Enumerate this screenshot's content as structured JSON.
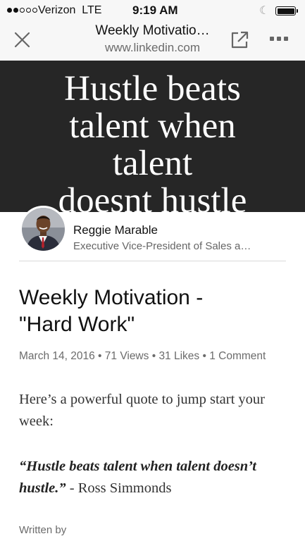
{
  "status_bar": {
    "carrier": "Verizon",
    "network": "LTE",
    "time": "9:19 AM",
    "signal_bars_filled": 2,
    "signal_bars_total": 5,
    "battery_level": 1.0
  },
  "nav": {
    "title": "Weekly Motivatio…",
    "url": "www.linkedin.com"
  },
  "hero": {
    "lines": [
      "Hustle beats",
      "talent when",
      "talent",
      "doesnt hustle"
    ]
  },
  "author": {
    "name": "Reggie Marable",
    "headline": "Executive Vice-President of Sales a…"
  },
  "article": {
    "title_line1": "Weekly Motivation -",
    "title_line2": "\"Hard Work\"",
    "date": "March 14, 2016",
    "views": "71 Views",
    "likes": "31 Likes",
    "comments": "1 Comment",
    "intro": "Here’s a powerful quote to jump start your week:",
    "quote": "“Hustle beats talent when talent doesn’t hustle.”",
    "attribution": " - Ross Simmonds",
    "written_by": "Written by"
  },
  "colors": {
    "hero_bg": "#262626",
    "bar_bg": "#f7f7f7",
    "meta_text": "#6b6b6b"
  }
}
